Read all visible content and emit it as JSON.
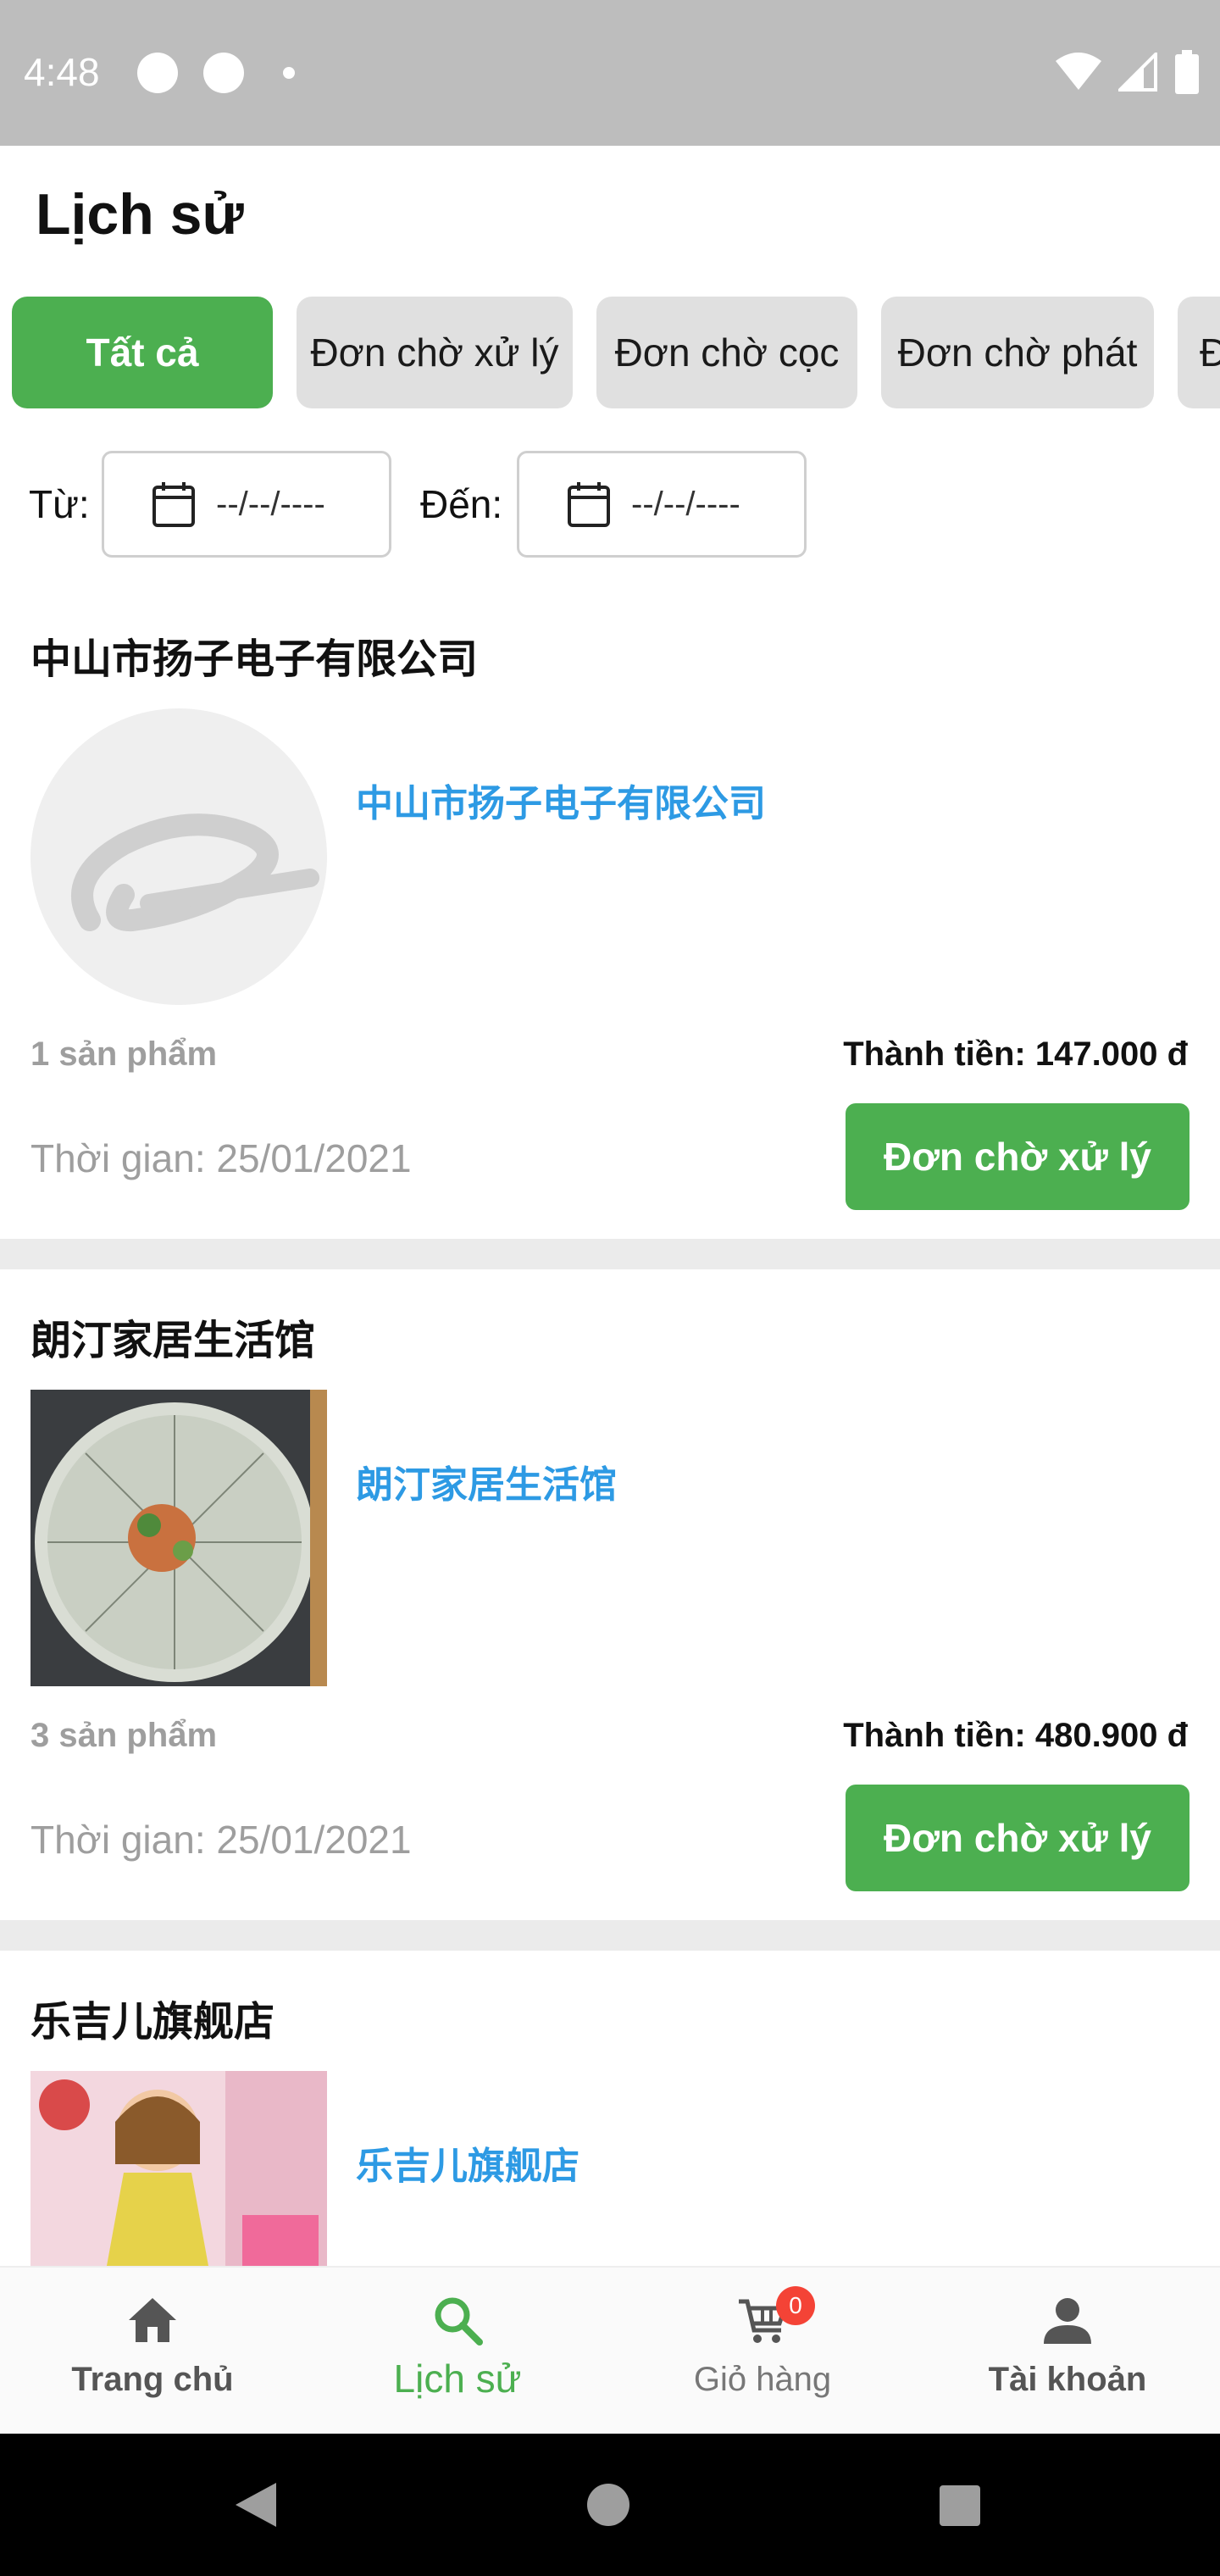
{
  "status_bar": {
    "time": "4:48"
  },
  "header": {
    "title": "Lịch sử"
  },
  "tabs": [
    {
      "label": "Tất cả",
      "active": true
    },
    {
      "label": "Đơn chờ xử lý",
      "active": false
    },
    {
      "label": "Đơn chờ cọc",
      "active": false
    },
    {
      "label": "Đơn chờ phát",
      "active": false
    },
    {
      "label": "Đ",
      "active": false
    }
  ],
  "date_filter": {
    "from_label": "Từ:",
    "to_label": "Đến:",
    "from_value": "--/--/----",
    "to_value": "--/--/----"
  },
  "orders": [
    {
      "shop": "中山市扬子电子有限公司",
      "shop_link": "中山市扬子电子有限公司",
      "count": "1 sản phẩm",
      "total": "Thành tiền: 147.000 đ",
      "time": "Thời gian: 25/01/2021",
      "status": "Đơn chờ xử lý"
    },
    {
      "shop": "朗汀家居生活馆",
      "shop_link": "朗汀家居生活馆",
      "count": "3 sản phẩm",
      "total": "Thành tiền: 480.900 đ",
      "time": "Thời gian: 25/01/2021",
      "status": "Đơn chờ xử lý"
    },
    {
      "shop": "乐吉儿旗舰店",
      "shop_link": "乐吉儿旗舰店"
    }
  ],
  "bottom_nav": [
    {
      "label": "Trang chủ",
      "icon": "home-icon",
      "active": false
    },
    {
      "label": "Lịch sử",
      "icon": "search-icon",
      "active": true
    },
    {
      "label": "Giỏ hàng",
      "icon": "cart-icon",
      "active": false,
      "badge": "0"
    },
    {
      "label": "Tài khoản",
      "icon": "person-icon",
      "active": false
    }
  ],
  "colors": {
    "accent": "#4caf50",
    "link": "#2d9ae4",
    "badge": "#f44336"
  }
}
